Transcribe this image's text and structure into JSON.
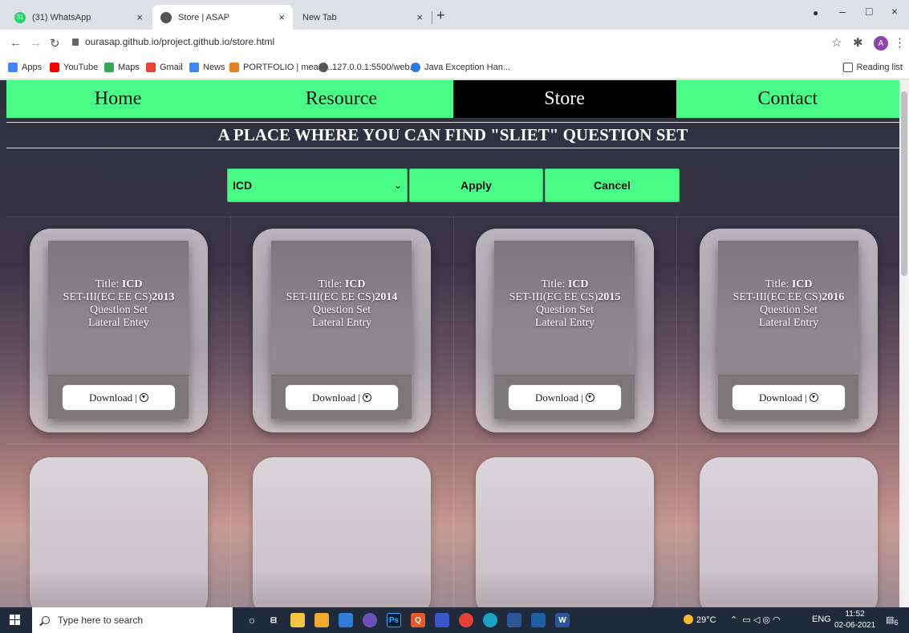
{
  "browser": {
    "tabs": [
      {
        "title": "(31) WhatsApp",
        "favicon_color": "#25d366",
        "favicon_text": "31",
        "active": false
      },
      {
        "title": "Store | ASAP",
        "favicon_color": "#555555",
        "favicon_text": "",
        "active": true
      },
      {
        "title": "New Tab",
        "favicon_color": "",
        "favicon_text": "",
        "active": false
      }
    ],
    "new_tab_icon": "plus-icon",
    "url": "ourasap.github.io/project.github.io/store.html",
    "profile_initial": "A",
    "bookmarks": [
      {
        "label": "Apps",
        "color": "#4285f4"
      },
      {
        "label": "YouTube",
        "color": "#ff0000"
      },
      {
        "label": "Maps",
        "color": "#34a853"
      },
      {
        "label": "Gmail",
        "color": "#ea4335"
      },
      {
        "label": "News",
        "color": "#4285f4"
      },
      {
        "label": "PORTFOLIO | meani...",
        "color": "#e67e22"
      },
      {
        "label": "127.0.0.1:5500/web...",
        "color": "#555555"
      },
      {
        "label": "Java Exception Han...",
        "color": "#2a7ae2"
      }
    ],
    "reading_list": "Reading list"
  },
  "page": {
    "nav": [
      {
        "label": "Home",
        "active": false
      },
      {
        "label": "Resource",
        "active": false
      },
      {
        "label": "Store",
        "active": true
      },
      {
        "label": "Contact",
        "active": false
      }
    ],
    "banner": "A PLACE WHERE YOU CAN FIND \"SLIET\" QUESTION SET",
    "filter": {
      "selected": "ICD",
      "apply": "Apply",
      "cancel": "Cancel"
    },
    "cards": [
      {
        "title_label": "Title: ",
        "title": "ICD",
        "set": "SET-III(EC EE CS)",
        "year": "2013",
        "line3": "Question Set",
        "line4": "Lateral Entey",
        "download": "Download | "
      },
      {
        "title_label": "Title: ",
        "title": "ICD",
        "set": "SET-III(EC EE CS)",
        "year": "2014",
        "line3": "Question Set",
        "line4": "Lateral Entry",
        "download": "Download | "
      },
      {
        "title_label": "Title: ",
        "title": "ICD",
        "set": "SET-III(EC EE CS)",
        "year": "2015",
        "line3": "Question Set",
        "line4": "Lateral Entry",
        "download": "Download | "
      },
      {
        "title_label": "Title: ",
        "title": "ICD",
        "set": "SET-III(EC EE CS)",
        "year": "2016",
        "line3": "Question Set",
        "line4": "Lateral Entry",
        "download": "Download | "
      }
    ],
    "accent_color": "#49fb87"
  },
  "taskbar": {
    "search_placeholder": "Type here to search",
    "weather": "29°C",
    "lang": "ENG",
    "time": "11:52",
    "date": "02-06-2021",
    "notifications": "6"
  }
}
